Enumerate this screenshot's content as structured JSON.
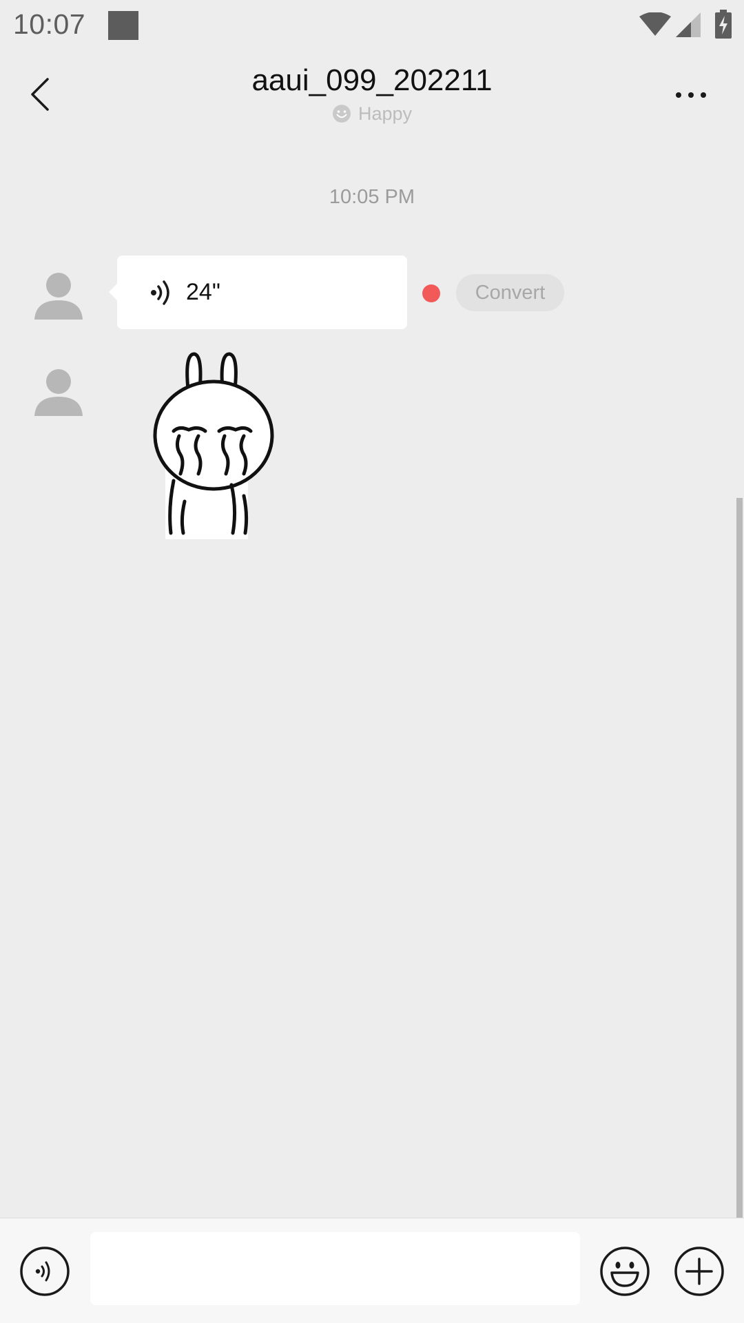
{
  "status_bar": {
    "time": "10:07",
    "icons": [
      "notification-square-icon",
      "wifi-icon",
      "cell-signal-icon",
      "battery-charging-icon"
    ]
  },
  "header": {
    "title": "aaui_099_202211",
    "status_text": "Happy",
    "back_icon": "chevron-left-icon",
    "more_icon": "more-horizontal-icon"
  },
  "messages": {
    "timestamp": "10:05 PM",
    "voice_message": {
      "duration": "24\"",
      "unread": true,
      "convert_label": "Convert"
    },
    "sticker": {
      "icon": "crying-rabbit-sticker"
    }
  },
  "input_bar": {
    "value": "",
    "placeholder": "",
    "voice_icon": "voice-input-icon",
    "emoji_icon": "emoji-icon",
    "plus_icon": "plus-circle-icon"
  },
  "colors": {
    "background": "#ededed",
    "bubble": "#ffffff",
    "unread_dot": "#f25a5a",
    "input_bar": "#f7f7f7"
  }
}
